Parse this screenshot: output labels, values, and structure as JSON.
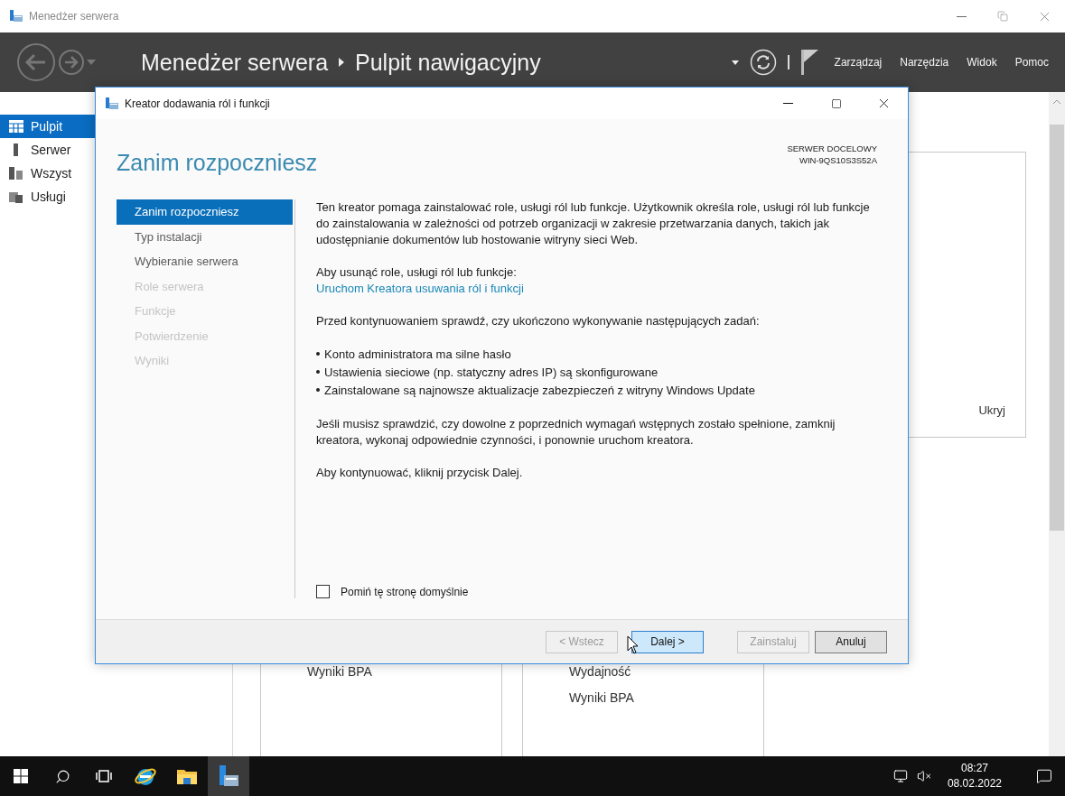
{
  "app_window": {
    "title": "Menedżer serwera"
  },
  "header": {
    "breadcrumb": [
      "Menedżer serwera",
      "Pulpit nawigacyjny"
    ],
    "menu": [
      "Zarządzaj",
      "Narzędzia",
      "Widok",
      "Pomoc"
    ]
  },
  "sidebar": {
    "items": [
      {
        "label": "Pulpit",
        "selected": true
      },
      {
        "label": "Serwer",
        "selected": false
      },
      {
        "label": "Wszyst",
        "selected": false
      },
      {
        "label": "Usługi",
        "selected": false
      }
    ]
  },
  "background": {
    "hide_link": "Ukryj",
    "tiles": [
      {
        "rows": [
          "Wyniki BPA"
        ]
      },
      {
        "rows": [
          "Wydajność",
          "Wyniki BPA"
        ]
      }
    ]
  },
  "dialog": {
    "title": "Kreator dodawania ról i funkcji",
    "heading": "Zanim rozpoczniesz",
    "target_label": "SERWER DOCELOWY",
    "target_server": "WIN-9QS10S3S52A",
    "steps": [
      {
        "label": "Zanim rozpoczniesz",
        "selected": true,
        "disabled": false
      },
      {
        "label": "Typ instalacji",
        "selected": false,
        "disabled": false
      },
      {
        "label": "Wybieranie serwera",
        "selected": false,
        "disabled": false
      },
      {
        "label": "Role serwera",
        "selected": false,
        "disabled": true
      },
      {
        "label": "Funkcje",
        "selected": false,
        "disabled": true
      },
      {
        "label": "Potwierdzenie",
        "selected": false,
        "disabled": true
      },
      {
        "label": "Wyniki",
        "selected": false,
        "disabled": true
      }
    ],
    "blocks": [
      {
        "kind": "text",
        "text": "Ten kreator pomaga zainstalować role, usługi ról lub funkcje. Użytkownik określa role, usługi ról lub funkcje do zainstalowania w zależności od potrzeb organizacji w zakresie przetwarzania danych, takich jak udostępnianie dokumentów lub hostowanie witryny sieci Web."
      },
      {
        "kind": "link",
        "text": "Aby usunąć role, usługi ról lub funkcje:",
        "link": "Uruchom Kreatora usuwania ról i funkcji"
      },
      {
        "kind": "text",
        "text": "Przed kontynuowaniem sprawdź, czy ukończono wykonywanie następujących zadań:"
      },
      {
        "kind": "bullets",
        "items": [
          "Konto administratora ma silne hasło",
          "Ustawienia sieciowe (np. statyczny adres IP) są skonfigurowane",
          "Zainstalowane są najnowsze aktualizacje zabezpieczeń z witryny Windows Update"
        ]
      },
      {
        "kind": "text",
        "text": "Jeśli musisz sprawdzić, czy dowolne z poprzednich wymagań wstępnych zostało spełnione, zamknij kreatora, wykonaj odpowiednie czynności, i ponownie uruchom kreatora."
      },
      {
        "kind": "text",
        "text": "Aby kontynuować, kliknij przycisk Dalej."
      }
    ],
    "skip_checkbox": {
      "label": "Pomiń tę stronę domyślnie",
      "checked": false
    },
    "buttons": [
      {
        "label": "< Wstecz",
        "disabled": true,
        "hovered": false
      },
      {
        "label": "Dalej >",
        "disabled": false,
        "hovered": true
      },
      {
        "label": "Zainstaluj",
        "disabled": true,
        "hovered": false
      },
      {
        "label": "Anuluj",
        "disabled": false,
        "hovered": false
      }
    ]
  },
  "taskbar": {
    "time": "08:27",
    "date": "08.02.2022"
  }
}
